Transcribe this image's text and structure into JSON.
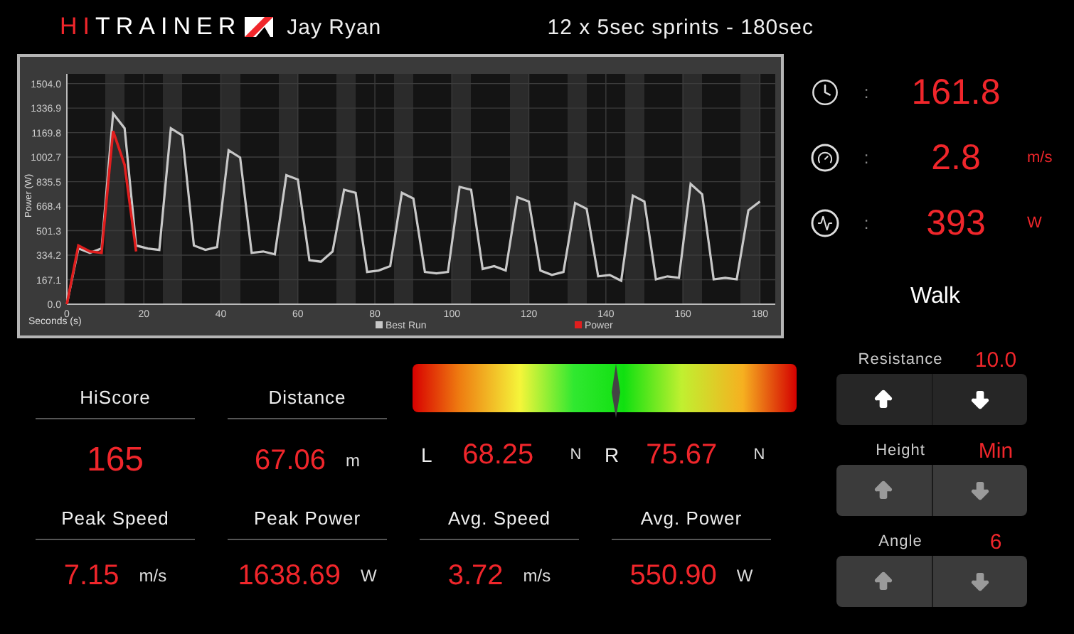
{
  "header": {
    "brand": {
      "accent": "HI",
      "text": "TRAINER"
    },
    "user": "Jay Ryan",
    "workout": "12 x 5sec sprints - 180sec"
  },
  "chart": {
    "chart_data": {
      "type": "line",
      "grid": true,
      "legend": "bottom",
      "xlabel": "Seconds (s)",
      "ylabel": "Power (W)",
      "xlim": [
        0,
        184
      ],
      "ylim": [
        0,
        1570
      ],
      "xticks": [
        0,
        20,
        40,
        60,
        80,
        100,
        120,
        140,
        160,
        180
      ],
      "yticks": [
        {
          "value": 0,
          "label": "0.0"
        },
        {
          "value": 167.1,
          "label": "167.1"
        },
        {
          "value": 334.2,
          "label": "334.2"
        },
        {
          "value": 501.3,
          "label": "501.3"
        },
        {
          "value": 668.4,
          "label": "668.4"
        },
        {
          "value": 835.5,
          "label": "835.5"
        },
        {
          "value": 1002.7,
          "label": "1002.7"
        },
        {
          "value": 1169.8,
          "label": "1169.8"
        },
        {
          "value": 1336.9,
          "label": "1336.9"
        },
        {
          "value": 1504.0,
          "label": "1504.0"
        }
      ],
      "x": [
        0,
        3,
        6,
        9,
        12,
        15,
        18,
        21,
        24,
        27,
        30,
        33,
        36,
        39,
        42,
        45,
        48,
        51,
        54,
        57,
        60,
        63,
        66,
        69,
        72,
        75,
        78,
        81,
        84,
        87,
        90,
        93,
        96,
        99,
        102,
        105,
        108,
        111,
        114,
        117,
        120,
        123,
        126,
        129,
        132,
        135,
        138,
        141,
        144,
        147,
        150,
        153,
        156,
        159,
        162,
        165,
        168,
        171,
        174,
        177,
        180
      ],
      "series": [
        {
          "name": "Best Run",
          "color": "#c8c8c8",
          "values": [
            0,
            380,
            350,
            380,
            1300,
            1200,
            400,
            380,
            370,
            1200,
            1150,
            400,
            370,
            390,
            1050,
            1000,
            350,
            360,
            340,
            880,
            850,
            300,
            290,
            360,
            780,
            760,
            220,
            230,
            260,
            760,
            720,
            220,
            210,
            220,
            800,
            780,
            240,
            260,
            230,
            730,
            700,
            230,
            200,
            220,
            690,
            650,
            190,
            200,
            160,
            740,
            700,
            170,
            190,
            180,
            820,
            750,
            170,
            180,
            170,
            640,
            700
          ]
        },
        {
          "name": "Power",
          "color": "#e01e1e",
          "values": [
            0,
            400,
            360,
            350,
            1180,
            950,
            360,
            null,
            null,
            null,
            null,
            null,
            null,
            null,
            null,
            null,
            null,
            null,
            null,
            null,
            null,
            null,
            null,
            null,
            null,
            null,
            null,
            null,
            null,
            null,
            null,
            null,
            null,
            null,
            null,
            null,
            null,
            null,
            null,
            null,
            null,
            null,
            null,
            null,
            null,
            null,
            null,
            null,
            null,
            null,
            null,
            null,
            null,
            null,
            null,
            null,
            null,
            null,
            null,
            null,
            null
          ]
        }
      ]
    }
  },
  "live_metrics": [
    {
      "kind": "time",
      "separator": ":",
      "value": "161.8"
    },
    {
      "kind": "speed",
      "separator": ":",
      "value": "2.8",
      "unit": "m/s"
    },
    {
      "kind": "power",
      "separator": ":",
      "value": "393",
      "unit": "W"
    }
  ],
  "mode": "Walk",
  "controls": [
    {
      "label": "Resistance",
      "value": "10.0",
      "disabled": false
    },
    {
      "label": "Height",
      "value": "Min",
      "disabled": true
    },
    {
      "label": "Angle",
      "value": "6",
      "disabled": true
    }
  ],
  "stats_top": [
    {
      "label": "HiScore",
      "value": "165"
    },
    {
      "label": "Distance",
      "value": "67.06",
      "unit": "m"
    }
  ],
  "balance": {
    "level": 0.53,
    "left": {
      "side": "L",
      "value": "68.25",
      "unit": "N"
    },
    "right": {
      "side": "R",
      "value": "75.67",
      "unit": "N"
    }
  },
  "stats_bottom": [
    {
      "label": "Peak Speed",
      "value": "7.15",
      "unit": "m/s"
    },
    {
      "label": "Peak Power",
      "value": "1638.69",
      "unit": "W"
    },
    {
      "label": "Avg. Speed",
      "value": "3.72",
      "unit": "m/s"
    },
    {
      "label": "Avg. Power",
      "value": "550.90",
      "unit": "W"
    }
  ]
}
